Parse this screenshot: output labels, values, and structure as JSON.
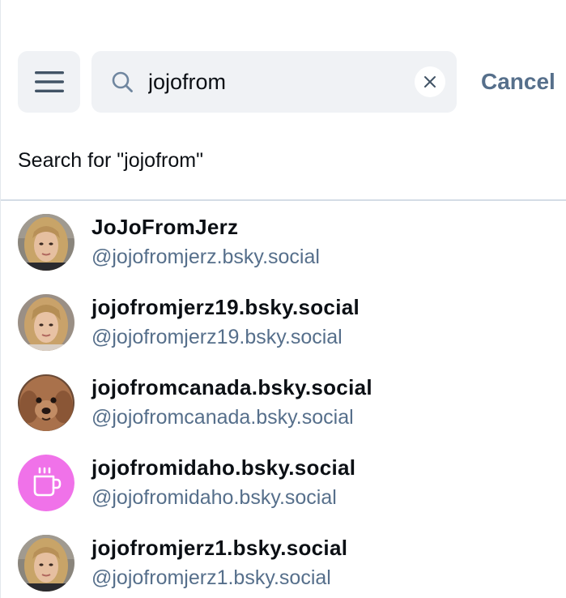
{
  "search": {
    "value": "jojofrom",
    "cancel_label": "Cancel",
    "suggestion": "Search for \"jojofrom\""
  },
  "results": [
    {
      "display_name": "JoJoFromJerz",
      "handle": "@jojofromjerz.bsky.social",
      "avatar": "photo-woman-blonde"
    },
    {
      "display_name": "jojofromjerz19.bsky.social",
      "handle": "@jojofromjerz19.bsky.social",
      "avatar": "photo-woman-blonde"
    },
    {
      "display_name": "jojofromcanada.bsky.social",
      "handle": "@jojofromcanada.bsky.social",
      "avatar": "photo-dog"
    },
    {
      "display_name": "jojofromidaho.bsky.social",
      "handle": "@jojofromidaho.bsky.social",
      "avatar": "mug-icon",
      "avatar_color": "#f072e9"
    },
    {
      "display_name": "jojofromjerz1.bsky.social",
      "handle": "@jojofromjerz1.bsky.social",
      "avatar": "photo-woman-blonde"
    }
  ],
  "colors": {
    "accent_text": "#566f8b",
    "input_bg": "#f0f2f5",
    "divider": "#d4dde6"
  }
}
